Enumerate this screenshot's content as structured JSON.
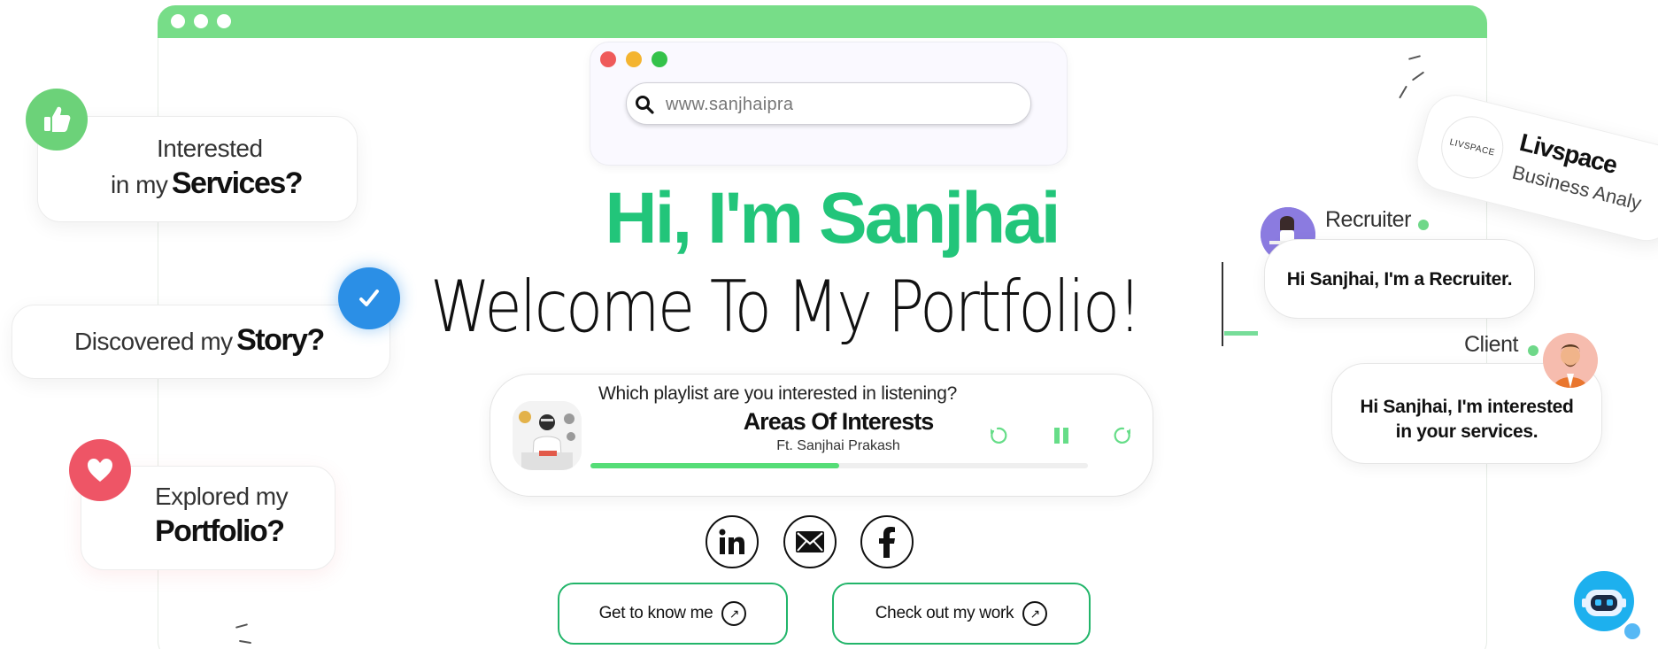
{
  "browser": {
    "url_placeholder": "www.sanjhaipra",
    "frame_color": "#77dd88"
  },
  "hero": {
    "name": "Hi, I'm Sanjhai",
    "subtitle": "Welcome To My Portfolio!"
  },
  "left_cards": {
    "services": {
      "line1": "Interested",
      "line2_thin": "in my",
      "line2_bold": "Services?",
      "icon": "thumbs-up-icon"
    },
    "story": {
      "thin": "Discovered my",
      "bold": "Story?",
      "icon": "check-icon"
    },
    "portfolio": {
      "line1": "Explored my",
      "line2_bold": "Portfolio?",
      "icon": "heart-icon"
    }
  },
  "player": {
    "question": "Which playlist are you interested in listening?",
    "title": "Areas Of Interests",
    "artist": "Ft. Sanjhai Prakash",
    "progress": 0.5,
    "controls": [
      "rewind-icon",
      "pause-icon",
      "forward-icon"
    ]
  },
  "socials": [
    "linkedin-icon",
    "mail-icon",
    "facebook-icon"
  ],
  "cta": {
    "know_me": "Get to know me",
    "work": "Check out my work"
  },
  "chat": {
    "recruiter_role": "Recruiter",
    "recruiter_msg": "Hi Sanjhai, I'm a Recruiter.",
    "client_role": "Client",
    "client_msg_line1": "Hi Sanjhai, I'm interested",
    "client_msg_line2": "in your services."
  },
  "experience": {
    "logo_text": "LIVSPACE",
    "company": "Livspace",
    "role": "Business Analy"
  },
  "colors": {
    "brand_green": "#22c57a",
    "accent_green": "#77dd88",
    "red": "#ee5566",
    "blue": "#2b8fe6"
  }
}
